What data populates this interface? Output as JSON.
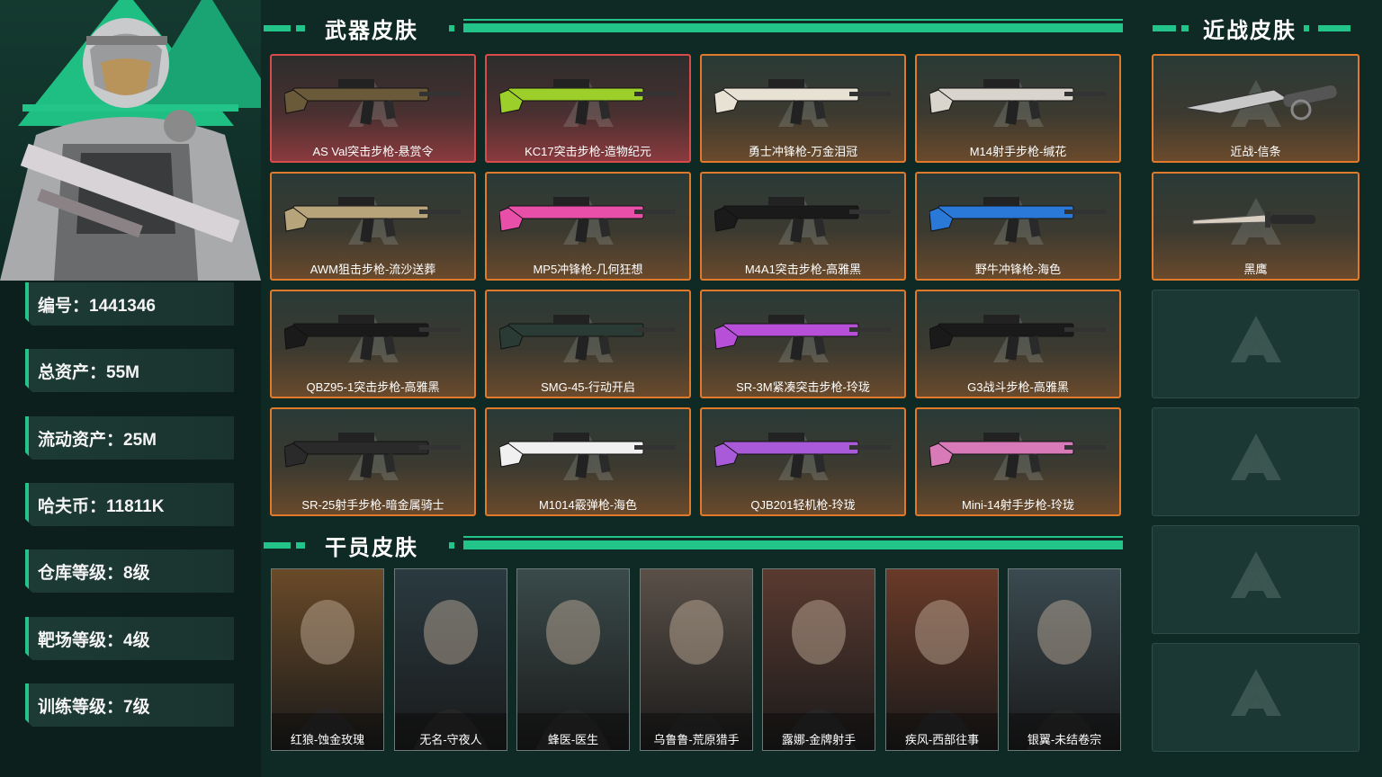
{
  "sections": {
    "weapons_title": "武器皮肤",
    "melee_title": "近战皮肤",
    "operators_title": "干员皮肤"
  },
  "stats": [
    {
      "text": "编号：1441346"
    },
    {
      "text": "总资产：55M"
    },
    {
      "text": "流动资产：25M"
    },
    {
      "text": "哈夫币：11811K"
    },
    {
      "text": "仓库等级：8级"
    },
    {
      "text": "靶场等级：4级"
    },
    {
      "text": "训练等级：7级"
    }
  ],
  "weapons": [
    {
      "label": "AS Val突击步枪-悬赏令",
      "rarity": "red",
      "color": "#6b5a3a"
    },
    {
      "label": "KC17突击步枪-造物纪元",
      "rarity": "red",
      "color": "#9ccf2a"
    },
    {
      "label": "勇士冲锋枪-万金泪冠",
      "rarity": "orange",
      "color": "#e8e2d4"
    },
    {
      "label": "M14射手步枪-缄花",
      "rarity": "orange",
      "color": "#d9d4cc"
    },
    {
      "label": "AWM狙击步枪-流沙送葬",
      "rarity": "orange",
      "color": "#b8a47a"
    },
    {
      "label": "MP5冲锋枪-几何狂想",
      "rarity": "orange",
      "color": "#e84fa8"
    },
    {
      "label": "M4A1突击步枪-高雅黑",
      "rarity": "orange",
      "color": "#1a1a1a"
    },
    {
      "label": "野牛冲锋枪-海色",
      "rarity": "orange",
      "color": "#2a78d8"
    },
    {
      "label": "QBZ95-1突击步枪-高雅黑",
      "rarity": "orange",
      "color": "#1a1a1a"
    },
    {
      "label": "SMG-45-行动开启",
      "rarity": "orange",
      "color": "#2a3a34"
    },
    {
      "label": "SR-3M紧凑突击步枪-玲珑",
      "rarity": "orange",
      "color": "#b84fd8"
    },
    {
      "label": "G3战斗步枪-高雅黑",
      "rarity": "orange",
      "color": "#1a1a1a"
    },
    {
      "label": "SR-25射手步枪-暗金属骑士",
      "rarity": "orange",
      "color": "#2a2a2a"
    },
    {
      "label": "M1014霰弹枪-海色",
      "rarity": "orange",
      "color": "#f0f0f0"
    },
    {
      "label": "QJB201轻机枪-玲珑",
      "rarity": "orange",
      "color": "#a85ad8"
    },
    {
      "label": "Mini-14射手步枪-玲珑",
      "rarity": "orange",
      "color": "#d87ab8"
    }
  ],
  "melee": [
    {
      "label": "近战-信条"
    },
    {
      "label": "黑鹰"
    }
  ],
  "operators": [
    {
      "label": "红狼-蚀金玫瑰",
      "tint": "#6a4a28"
    },
    {
      "label": "无名-守夜人",
      "tint": "#2a3a40"
    },
    {
      "label": "蜂医-医生",
      "tint": "#3a4a4a"
    },
    {
      "label": "乌鲁鲁-荒原猎手",
      "tint": "#5a5048"
    },
    {
      "label": "露娜-金牌射手",
      "tint": "#5a3a30"
    },
    {
      "label": "疾风-西部往事",
      "tint": "#6a3a28"
    },
    {
      "label": "银翼-未结卷宗",
      "tint": "#3a4a50"
    }
  ]
}
